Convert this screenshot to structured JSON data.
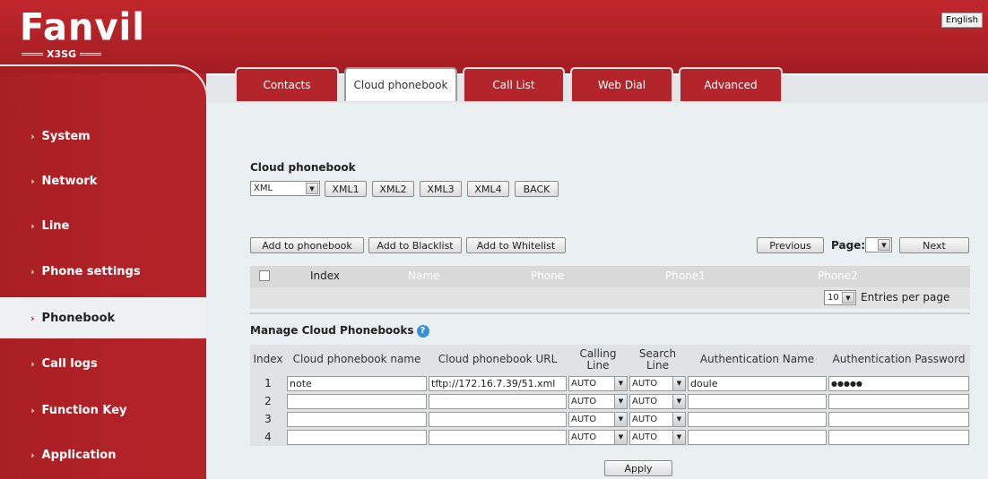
{
  "brand": {
    "logo": "Fanvil",
    "model": "X3SG"
  },
  "language_button": "English",
  "sidebar": {
    "items": [
      {
        "label": "System"
      },
      {
        "label": "Network"
      },
      {
        "label": "Line"
      },
      {
        "label": "Phone settings"
      },
      {
        "label": "Phonebook"
      },
      {
        "label": "Call logs"
      },
      {
        "label": "Function Key"
      },
      {
        "label": "Application"
      }
    ],
    "active": "Phonebook"
  },
  "tabs": [
    {
      "label": "Contacts"
    },
    {
      "label": "Cloud phonebook"
    },
    {
      "label": "Call List"
    },
    {
      "label": "Web Dial"
    },
    {
      "label": "Advanced"
    }
  ],
  "active_tab": "Cloud phonebook",
  "cloud_phonebook": {
    "title": "Cloud phonebook",
    "select_value": "XML",
    "buttons": [
      "XML1",
      "XML2",
      "XML3",
      "XML4",
      "BACK"
    ]
  },
  "actions": {
    "add_to_phonebook": "Add to phonebook",
    "add_to_blacklist": "Add to Blacklist",
    "add_to_whitelist": "Add to Whitelist",
    "previous": "Previous",
    "page_label": "Page:",
    "next": "Next"
  },
  "results_grid": {
    "columns": [
      "Index",
      "Name",
      "Phone",
      "Phone1",
      "Phone2"
    ],
    "entries_per_page_value": "10",
    "entries_per_page_label": "Entries per page"
  },
  "manage": {
    "title": "Manage Cloud Phonebooks",
    "headers": {
      "index": "Index",
      "name": "Cloud phonebook name",
      "url": "Cloud phonebook URL",
      "calling_line": "Calling Line",
      "search_line": "Search Line",
      "auth_name": "Authentication Name",
      "auth_password": "Authentication Password"
    },
    "rows": [
      {
        "index": "1",
        "name": "note",
        "url": "tftp://172.16.7.39/51.xml",
        "calling_line": "AUTO",
        "search_line": "AUTO",
        "auth_name": "doule",
        "auth_password": "●●●●●"
      },
      {
        "index": "2",
        "name": "",
        "url": "",
        "calling_line": "AUTO",
        "search_line": "AUTO",
        "auth_name": "",
        "auth_password": ""
      },
      {
        "index": "3",
        "name": "",
        "url": "",
        "calling_line": "AUTO",
        "search_line": "AUTO",
        "auth_name": "",
        "auth_password": ""
      },
      {
        "index": "4",
        "name": "",
        "url": "",
        "calling_line": "AUTO",
        "search_line": "AUTO",
        "auth_name": "",
        "auth_password": ""
      }
    ],
    "apply": "Apply"
  },
  "icons": {
    "help": "help-icon",
    "dropdown": "chevron-down-icon",
    "nav": "chevron-right-icon"
  },
  "colors": {
    "brand_red": "#a91f24",
    "content_bg": "#eaf0f2",
    "help_blue": "#3c8fd0"
  }
}
